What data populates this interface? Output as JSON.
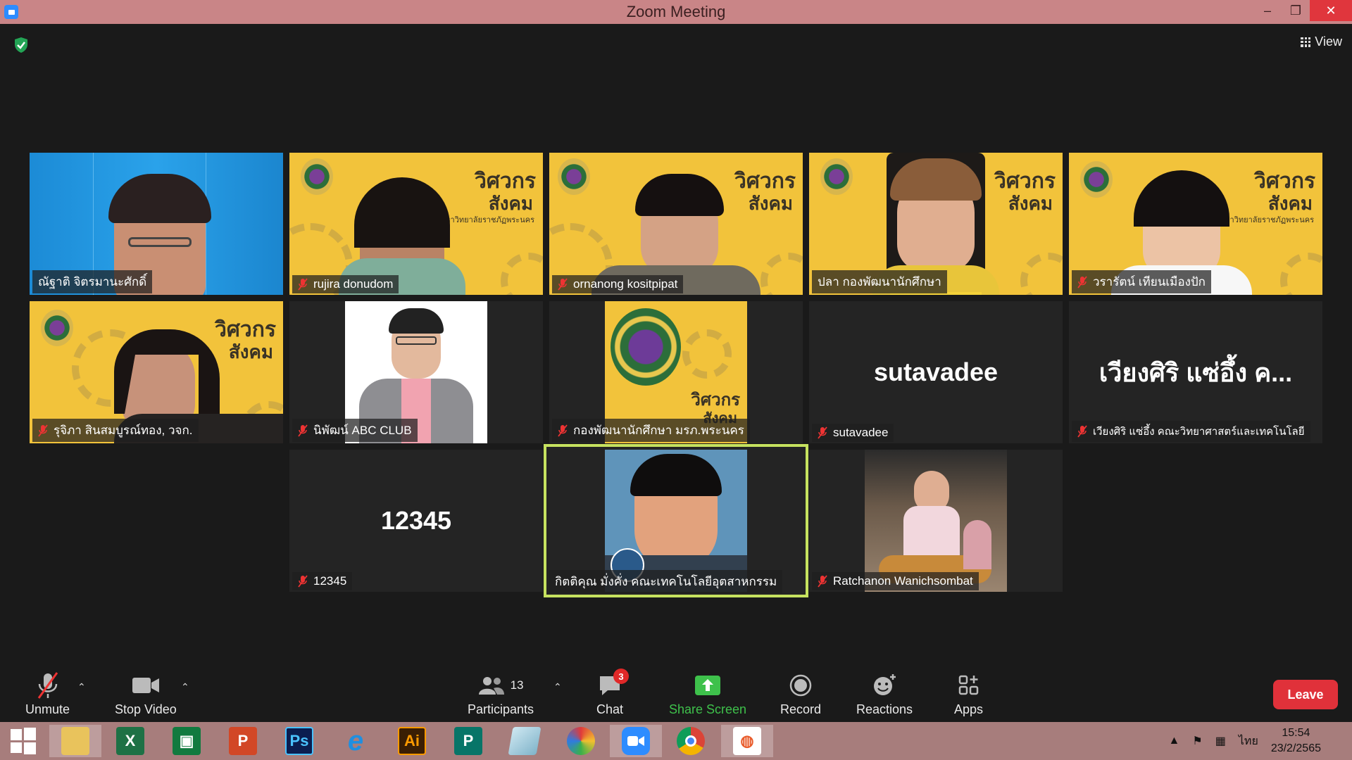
{
  "window": {
    "title": "Zoom Meeting"
  },
  "view_button": {
    "label": "View"
  },
  "participants": [
    {
      "name": "ณัฐาติ จิตรมานะศักดิ์",
      "muted": false,
      "kind": "video-blue"
    },
    {
      "name": "rujira donudom",
      "muted": true,
      "kind": "banner"
    },
    {
      "name": "ornanong kositpipat",
      "muted": true,
      "kind": "banner"
    },
    {
      "name": "ปลา กองพัฒนานักศึกษา",
      "muted": false,
      "kind": "banner"
    },
    {
      "name": "วรารัตน์ เทียนเมืองปัก",
      "muted": true,
      "kind": "banner"
    },
    {
      "name": "รุจิภา สินสมบูรณ์ทอง, วจก.",
      "muted": true,
      "kind": "banner"
    },
    {
      "name": "นิพัฒน์ ABC CLUB",
      "muted": true,
      "kind": "photo"
    },
    {
      "name": "กองพัฒนานักศึกษา มรภ.พระนคร",
      "muted": true,
      "kind": "logo"
    },
    {
      "name": "sutavadee",
      "muted": true,
      "kind": "text",
      "display": "sutavadee"
    },
    {
      "name": "เวียงศิริ แซ่อึ้ง คณะวิทยาศาสตร์และเทคโนโลยี",
      "muted": true,
      "kind": "text",
      "display": "เวียงศิริ แซ่อึ้ง ค..."
    },
    {
      "name": "12345",
      "muted": true,
      "kind": "text",
      "display": "12345"
    },
    {
      "name": "กิตติคุณ มั่งคั่ง คณะเทคโนโลยีอุตสาหกรรม",
      "muted": false,
      "kind": "cartoon",
      "active": true
    },
    {
      "name": "Ratchanon Wanichsombat",
      "muted": true,
      "kind": "photo2"
    }
  ],
  "banner": {
    "line1": "วิศวกร",
    "line2": "สังคม",
    "university": "มหาวิทยาลัยราชภัฏพระนคร"
  },
  "toolbar": {
    "unmute": "Unmute",
    "stop_video": "Stop Video",
    "participants": "Participants",
    "participants_count": "13",
    "chat": "Chat",
    "chat_badge": "3",
    "share_screen": "Share Screen",
    "record": "Record",
    "reactions": "Reactions",
    "apps": "Apps",
    "leave": "Leave"
  },
  "colors": {
    "share_green": "#3ec14b",
    "active_border": "#c6e25f",
    "leave_red": "#e0313a",
    "titlebar": "#c98587"
  },
  "taskbar": {
    "apps": [
      "file-explorer",
      "excel",
      "store",
      "powerpoint",
      "photoshop",
      "internet-explorer",
      "illustrator",
      "publisher",
      "notes",
      "photoscape",
      "zoom",
      "chrome",
      "paint"
    ],
    "ps_label": "Ps",
    "ai_label": "Ai",
    "x_label": "X",
    "p_label": "P",
    "lang": "ไทย",
    "time": "15:54",
    "date": "23/2/2565"
  }
}
